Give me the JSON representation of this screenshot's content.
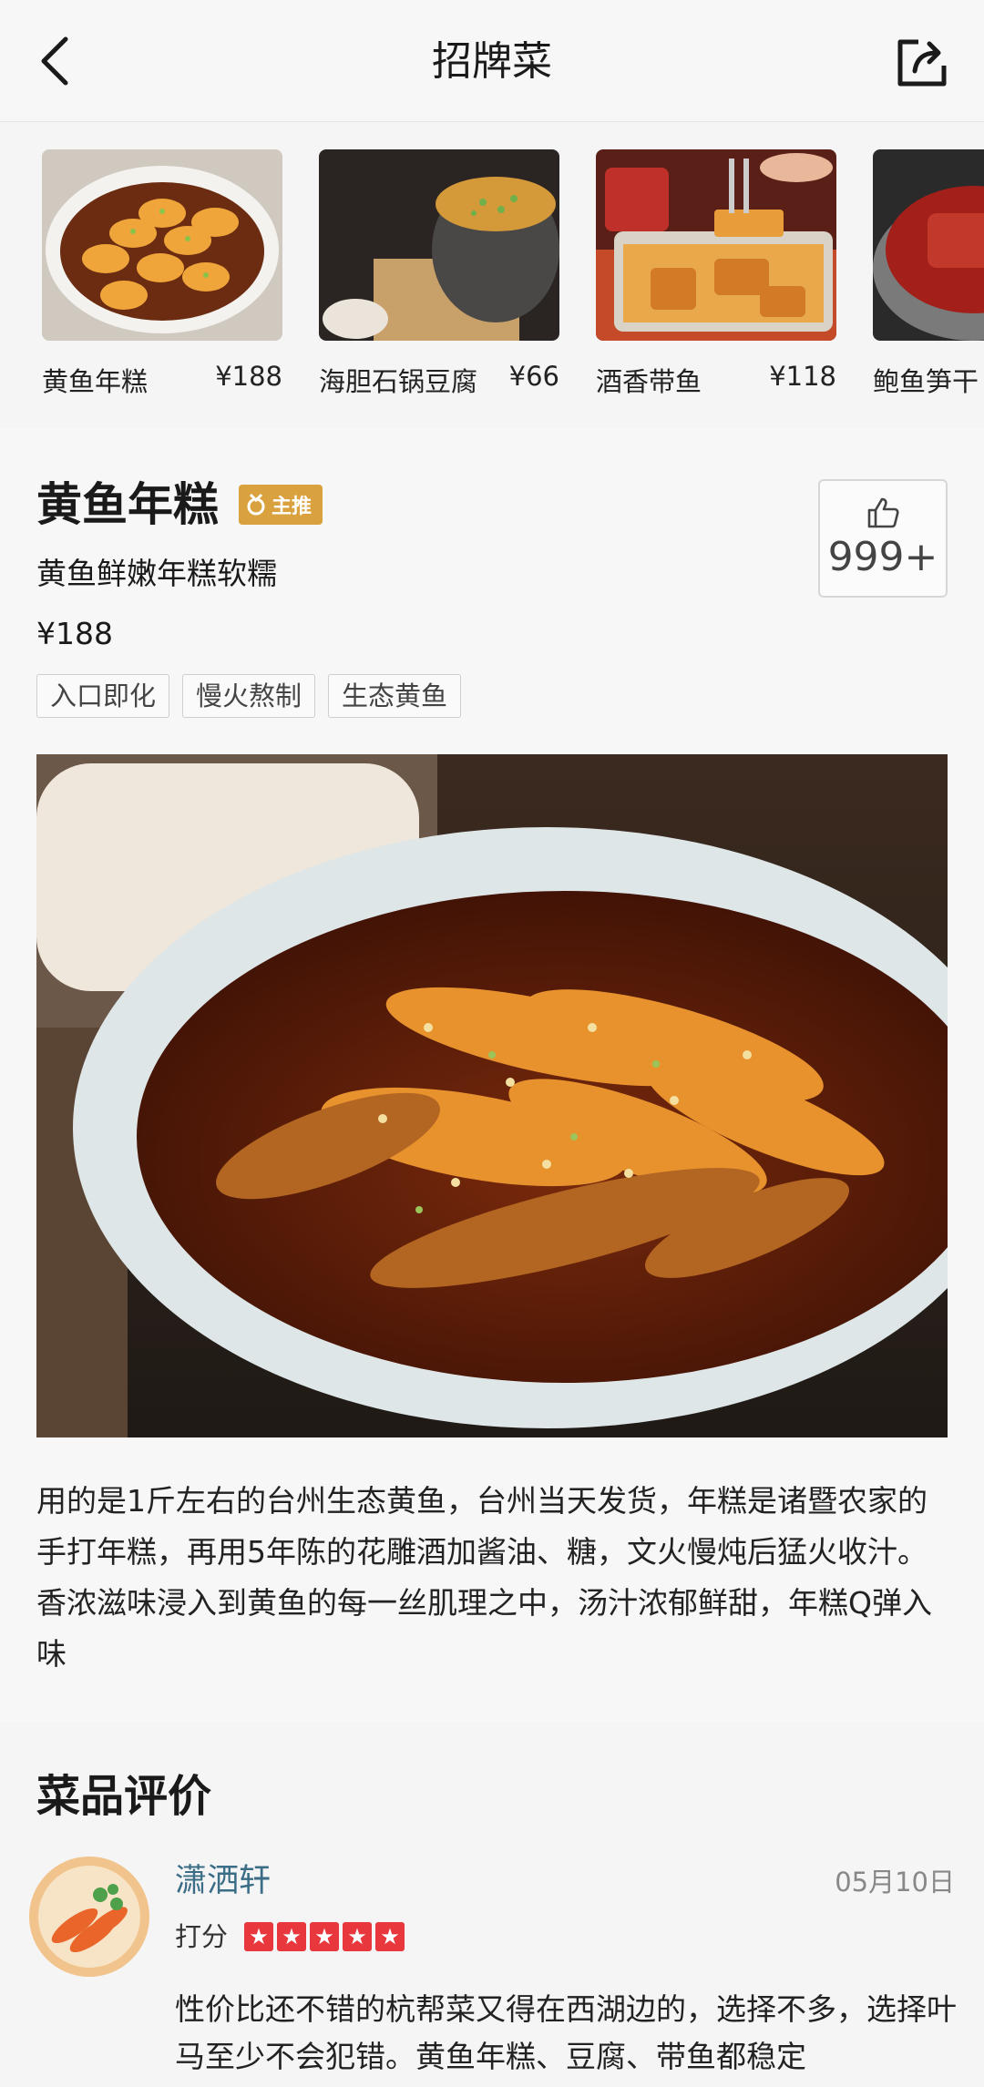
{
  "header": {
    "title": "招牌菜",
    "back_icon": "chevron-left-icon",
    "share_icon": "share-icon"
  },
  "dishes": [
    {
      "name": "黄鱼年糕",
      "price": "¥188"
    },
    {
      "name": "海胆石锅豆腐",
      "price": "¥66"
    },
    {
      "name": "酒香带鱼",
      "price": "¥118"
    },
    {
      "name": "鲍鱼笋干",
      "price": ""
    }
  ],
  "main_dish": {
    "title": "黄鱼年糕",
    "badge": "主推",
    "subtitle": "黄鱼鲜嫩年糕软糯",
    "price": "¥188",
    "tags": [
      "入口即化",
      "慢火熬制",
      "生态黄鱼"
    ],
    "likes": "999+",
    "description": "用的是1斤左右的台州生态黄鱼，台州当天发货，年糕是诸暨农家的手打年糕，再用5年陈的花雕酒加酱油、糖，文火慢炖后猛火收汁。香浓滋味浸入到黄鱼的每一丝肌理之中，汤汁浓郁鲜甜，年糕Q弹入味"
  },
  "reviews": {
    "title": "菜品评价",
    "items": [
      {
        "user": "潇洒轩",
        "date": "05月10日",
        "score_label": "打分",
        "rating": 5,
        "text": "性价比还不错的杭帮菜又得在西湖边的，选择不多，选择叶马至少不会犯错。黄鱼年糕、豆腐、带鱼都稳定"
      }
    ]
  },
  "colors": {
    "badge": "#d9a23e",
    "star": "#e8383d",
    "username": "#3b6d87"
  }
}
